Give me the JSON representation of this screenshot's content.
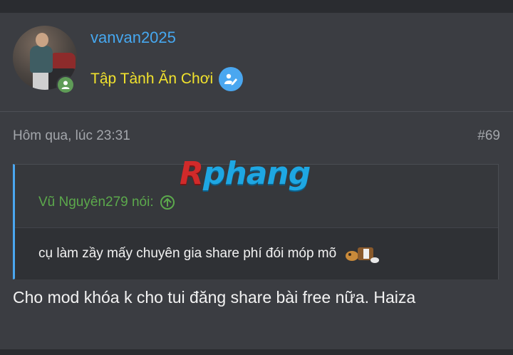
{
  "author": {
    "username": "vanvan2025",
    "title": "Tập Tành Ăn Chơi",
    "avatar_icon": "user-avatar-photo",
    "status": "online",
    "status_color": "#5f9c57",
    "verified_icon": "verified-writer-icon"
  },
  "post": {
    "timestamp": "Hôm qua, lúc 23:31",
    "number": "#69",
    "message": "Cho mod khóa k cho tui đăng share bài free nữa. Haiza"
  },
  "quote": {
    "author": "Vũ Nguyên279 nói:",
    "text": "cụ làm zầy mấy chuyên gia share phí đói móp mõ",
    "jump_icon": "arrow-up-circle-icon",
    "emoji_icon": "sticker-emoji-icon"
  },
  "watermark": {
    "first": "R",
    "rest": "phang"
  },
  "colors": {
    "username": "#46a8f0",
    "user_title": "#f1e22d",
    "quote_author": "#5ca94c",
    "accent": "#4aa7f0"
  }
}
